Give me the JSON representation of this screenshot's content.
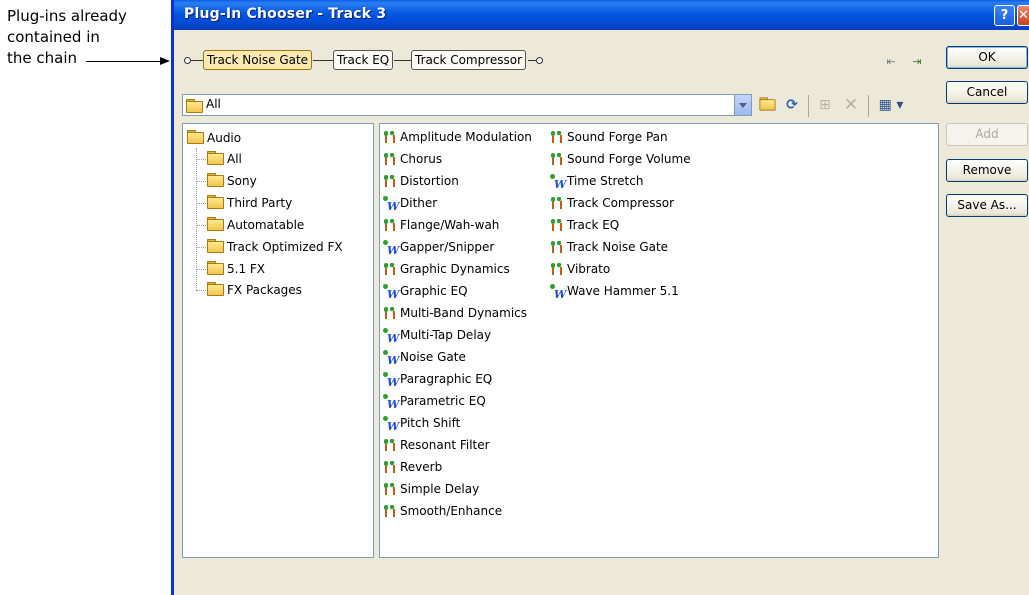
{
  "annotation": {
    "lines": [
      "Plug-ins already",
      "contained in",
      "the chain"
    ]
  },
  "window": {
    "title": "Plug-In Chooser - Track 3",
    "help_glyph": "?",
    "close_glyph": "✕"
  },
  "chain": {
    "items": [
      {
        "label": "Track Noise Gate",
        "selected": true
      },
      {
        "label": "Track EQ",
        "selected": false
      },
      {
        "label": "Track Compressor",
        "selected": false
      }
    ]
  },
  "buttons": {
    "ok": "OK",
    "cancel": "Cancel",
    "add": "Add",
    "remove": "Remove",
    "save_as": "Save As..."
  },
  "location": {
    "text": "All"
  },
  "tree": {
    "root": "Audio",
    "children": [
      "All",
      "Sony",
      "Third Party",
      "Automatable",
      "Track Optimized FX",
      "5.1 FX",
      "FX Packages"
    ]
  },
  "plugins": {
    "column1": [
      {
        "label": "Amplitude Modulation",
        "icon": "dx-plugin-icon"
      },
      {
        "label": "Chorus",
        "icon": "dx-plugin-icon"
      },
      {
        "label": "Distortion",
        "icon": "dx-plugin-icon"
      },
      {
        "label": "Dither",
        "icon": "vst-plugin-icon"
      },
      {
        "label": "Flange/Wah-wah",
        "icon": "dx-plugin-icon"
      },
      {
        "label": "Gapper/Snipper",
        "icon": "vst-plugin-icon"
      },
      {
        "label": "Graphic Dynamics",
        "icon": "dx-plugin-icon"
      },
      {
        "label": "Graphic EQ",
        "icon": "vst-plugin-icon"
      },
      {
        "label": "Multi-Band Dynamics",
        "icon": "dx-plugin-icon"
      },
      {
        "label": "Multi-Tap Delay",
        "icon": "vst-plugin-icon"
      },
      {
        "label": "Noise Gate",
        "icon": "vst-plugin-icon"
      },
      {
        "label": "Paragraphic EQ",
        "icon": "vst-plugin-icon"
      },
      {
        "label": "Parametric EQ",
        "icon": "vst-plugin-icon"
      },
      {
        "label": "Pitch Shift",
        "icon": "vst-plugin-icon"
      },
      {
        "label": "Resonant Filter",
        "icon": "dx-plugin-icon"
      },
      {
        "label": "Reverb",
        "icon": "dx-plugin-icon"
      },
      {
        "label": "Simple Delay",
        "icon": "dx-plugin-icon"
      },
      {
        "label": "Smooth/Enhance",
        "icon": "dx-plugin-icon"
      }
    ],
    "column2": [
      {
        "label": "Sound Forge Pan",
        "icon": "dx-plugin-icon"
      },
      {
        "label": "Sound Forge Volume",
        "icon": "dx-plugin-icon"
      },
      {
        "label": "Time Stretch",
        "icon": "vst-plugin-icon"
      },
      {
        "label": "Track Compressor",
        "icon": "dx-plugin-icon"
      },
      {
        "label": "Track EQ",
        "icon": "dx-plugin-icon"
      },
      {
        "label": "Track Noise Gate",
        "icon": "dx-plugin-icon"
      },
      {
        "label": "Vibrato",
        "icon": "dx-plugin-icon"
      },
      {
        "label": "Wave Hammer 5.1",
        "icon": "vst-plugin-icon"
      }
    ]
  },
  "colors": {
    "titlebar": "#0556e0",
    "dialog_bg": "#ece9d8",
    "selected_chain": "#fde8b0",
    "vst_blue": "#1f4fd1",
    "dx_green": "#2f9e2f"
  }
}
